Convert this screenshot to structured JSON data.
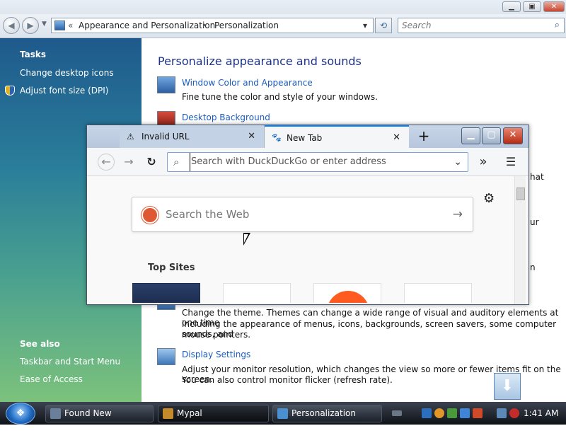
{
  "cp": {
    "back_icon": "back-arrow-icon",
    "address": {
      "chevron": "«",
      "crumb1": "Appearance and Personalization",
      "sep": "▸",
      "crumb2": "Personalization",
      "dropdown": "▾"
    },
    "refresh": "⟲",
    "search_placeholder": "Search",
    "search_icon": "⌕",
    "sidebar": {
      "tasks_heading": "Tasks",
      "tasks": [
        "Change desktop icons",
        "Adjust font size (DPI)"
      ],
      "see_also_heading": "See also",
      "see_also": [
        "Taskbar and Start Menu",
        "Ease of Access"
      ]
    },
    "main": {
      "title": "Personalize appearance and sounds",
      "items": [
        {
          "link": "Window Color and Appearance",
          "desc": "Fine tune the color and style of your windows."
        },
        {
          "link": "Desktop Background",
          "desc": ""
        },
        {
          "link": "",
          "desc1": "Change the theme. Themes can change a wide range of visual and auditory elements at one time",
          "desc2": "including the appearance of menus, icons, backgrounds, screen savers, some computer sounds, and",
          "desc3": "mouse pointers."
        },
        {
          "link": "Display Settings",
          "desc1": "Adjust your monitor resolution, which changes the view so more or fewer items fit on the screen.",
          "desc2": "You can also control monitor flicker (refresh rate)."
        }
      ],
      "peek": [
        "hat",
        "ur",
        "n"
      ]
    }
  },
  "ff": {
    "tabs": [
      {
        "title": "Invalid URL",
        "icon": "⚠",
        "close": "✕"
      },
      {
        "title": "New Tab",
        "icon": "🐾",
        "close": "✕"
      }
    ],
    "new_tab": "+",
    "url_placeholder": "Search with DuckDuckGo or enter address",
    "toolbar": {
      "back": "←",
      "forward": "→",
      "reload": "↻",
      "overflow": "»",
      "menu": "☰",
      "url_dropdown": "⌄",
      "search_glyph": "⌕"
    },
    "ddg_placeholder": "Search the Web",
    "ddg_arrow": "→",
    "gear": "⚙",
    "top_sites_label": "Top Sites"
  },
  "taskbar": {
    "start_glyph": "❖",
    "tasks": [
      {
        "label": "Found New Hardwa...",
        "color": "#6a7f9a"
      },
      {
        "label": "Mypal",
        "color": "#c58b2a"
      },
      {
        "label": "Personalization",
        "color": "#4b8fd3"
      }
    ],
    "clock": "1:41 AM"
  },
  "colors": {
    "link": "#1a5bbf",
    "title": "#1e3287",
    "accent": "#0a84ff"
  }
}
